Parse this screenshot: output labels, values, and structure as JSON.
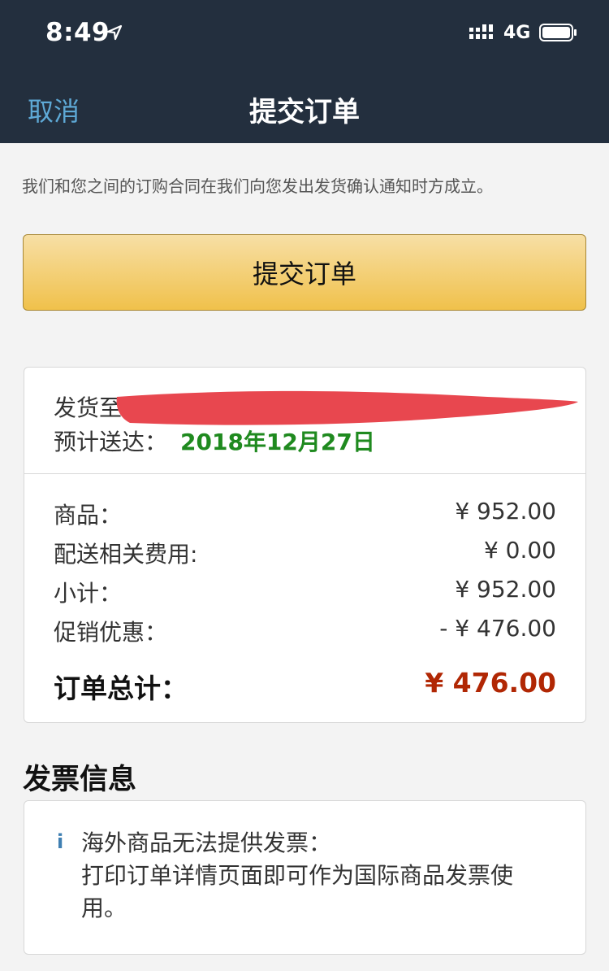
{
  "status_bar": {
    "time": "8:49",
    "network": "4G",
    "icons": [
      "location-arrow-icon",
      "signal-icon",
      "battery-icon"
    ]
  },
  "nav": {
    "cancel_label": "取消",
    "title": "提交订单"
  },
  "agreement_text": "我们和您之间的订购合同在我们向您发出发货确认通知时方成立。",
  "submit_button_label": "提交订单",
  "shipping": {
    "ship_to_label": "发货至",
    "eta_label": "预计送达：",
    "eta_value": "2018年12月27日"
  },
  "summary": {
    "items": [
      {
        "label": "商品：",
        "value": "¥ 952.00"
      },
      {
        "label": "配送相关费用:",
        "value": "¥ 0.00"
      },
      {
        "label": "小计：",
        "value": "¥ 952.00"
      },
      {
        "label": "促销优惠：",
        "value": "- ¥ 476.00"
      }
    ],
    "total_label": "订单总计：",
    "total_value": "¥ 476.00"
  },
  "invoice": {
    "title": "发票信息",
    "icon": "info-icon",
    "line1": "海外商品无法提供发票：",
    "line2": "打印订单详情页面即可作为国际商品发票使",
    "line3": "用。"
  },
  "colors": {
    "header_bg": "#232f3e",
    "link": "#5ea9d6",
    "button": "#f0c14b",
    "eta": "#1f8a1f",
    "total": "#b12704",
    "redaction": "#e8474f"
  }
}
